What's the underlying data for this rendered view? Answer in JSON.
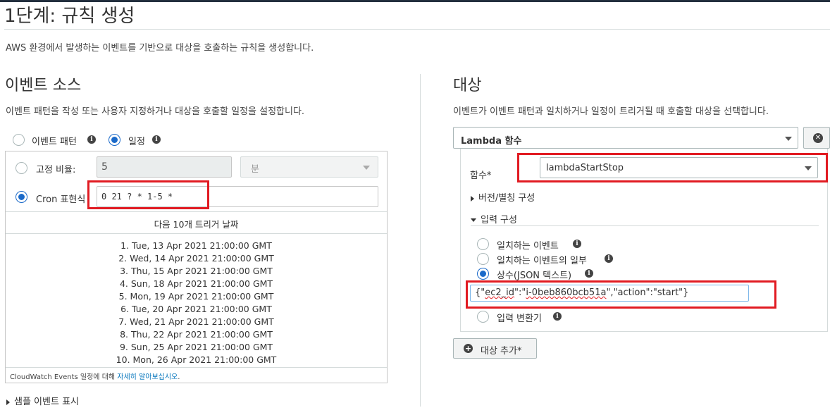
{
  "page": {
    "title": "1단계: 규칙 생성",
    "description": "AWS 환경에서 발생하는 이벤트를 기반으로 대상을 호출하는 규칙을 생성합니다."
  },
  "event_source": {
    "heading": "이벤트 소스",
    "description": "이벤트 패턴을 작성 또는 사용자 지정하거나 대상을 호출할 일정을 설정합니다.",
    "mode_options": [
      {
        "label": "이벤트 패턴",
        "selected": false
      },
      {
        "label": "일정",
        "selected": true
      }
    ],
    "fixed_rate": {
      "label": "고정 비율:",
      "value": "5",
      "unit": "분",
      "selected": false
    },
    "cron": {
      "label": "Cron 표현식",
      "value": "0 21 ? * 1-5 *",
      "selected": true
    },
    "next_triggers_title": "다음 10개 트리거 날짜",
    "next_triggers": [
      "1. Tue, 13 Apr 2021 21:00:00 GMT",
      "2. Wed, 14 Apr 2021 21:00:00 GMT",
      "3. Thu, 15 Apr 2021 21:00:00 GMT",
      "4. Sun, 18 Apr 2021 21:00:00 GMT",
      "5. Mon, 19 Apr 2021 21:00:00 GMT",
      "6. Tue, 20 Apr 2021 21:00:00 GMT",
      "7. Wed, 21 Apr 2021 21:00:00 GMT",
      "8. Thu, 22 Apr 2021 21:00:00 GMT",
      "9. Sun, 25 Apr 2021 21:00:00 GMT",
      "10. Mon, 26 Apr 2021 21:00:00 GMT"
    ],
    "footnote_prefix": "CloudWatch Events 일정에 대해 ",
    "footnote_link": "자세히 알아보십시오",
    "footnote_suffix": ".",
    "sample_toggle": "샘플 이벤트 표시"
  },
  "target": {
    "heading": "대상",
    "description": "이벤트가 이벤트 패턴과 일치하거나 일정이 트리거될 때 호출할 대상을 선택합니다.",
    "type_value": "Lambda 함수",
    "function_label": "함수*",
    "function_value": "lambdaStartStop",
    "version_toggle": "버전/별칭 구성",
    "input_toggle": "입력 구성",
    "input_options": [
      {
        "label": "일치하는 이벤트",
        "selected": false,
        "info": true
      },
      {
        "label": "일치하는 이벤트의 일부",
        "selected": false,
        "info": true
      },
      {
        "label": "상수(JSON 텍스트)",
        "selected": true,
        "info": true
      }
    ],
    "json_prefix": "{\"",
    "json_key": "ec2_id",
    "json_mid": "\":\"",
    "json_id": "i-0beb860bcb51a",
    "json_suffix": "\",\"action\":\"start\"}",
    "input_transformer": "입력 변환기",
    "add_target_label": "대상 추가*"
  },
  "colors": {
    "highlight": "#e11b22",
    "selected_radio": "#1b6ac9",
    "link": "#0073bb"
  }
}
